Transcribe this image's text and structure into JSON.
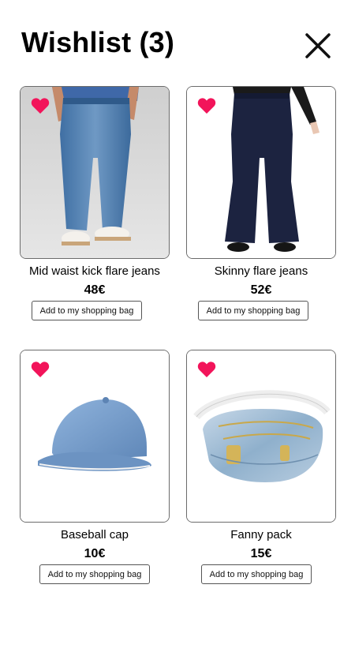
{
  "header": {
    "title": "Wishlist (3)"
  },
  "colors": {
    "heart": "#f2145a",
    "border": "#6b6b6b",
    "text": "#000000",
    "background": "#ffffff"
  },
  "items": [
    {
      "name": "Mid waist kick flare jeans",
      "price": "48€",
      "button_label": "Add to my shopping bag",
      "favorite": true,
      "image": "jeans-photo"
    },
    {
      "name": "Skinny flare jeans",
      "price": "52€",
      "button_label": "Add to my shopping bag",
      "favorite": true,
      "image": "flare-jeans-photo"
    },
    {
      "name": "Baseball cap",
      "price": "10€",
      "button_label": "Add to my shopping bag",
      "favorite": true,
      "image": "cap-photo"
    },
    {
      "name": "Fanny pack",
      "price": "15€",
      "button_label": "Add to my shopping bag",
      "favorite": true,
      "image": "fanny-pack-photo"
    }
  ]
}
